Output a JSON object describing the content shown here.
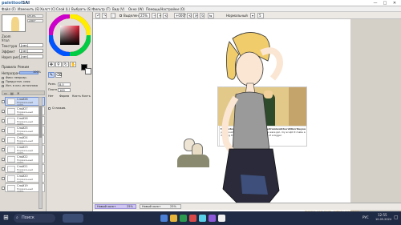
{
  "app": {
    "logo_prefix": "painttool",
    "logo_name": "SAI"
  },
  "window_controls": {
    "minimize": "—",
    "maximize": "□",
    "close": "✕"
  },
  "menu": [
    "Файл (F)",
    "Изменить (E)",
    "Холст (C)",
    "Слой (L)",
    "Выбрать (S)",
    "Фильтр (T)",
    "Вид (V)",
    "Окно (W)",
    "Помощь/Настройки (O)"
  ],
  "toolbar": {
    "selection_label": "Выделение",
    "zoom": "25%",
    "angle": "+000°",
    "mode_label": "Нормальный",
    "stabilizer": "5"
  },
  "sidebar": {
    "navigator": {
      "zoom_label": "Zoom",
      "zoom_value": "25,0%",
      "angle_label": "Угол",
      "angle_value": "+000°"
    },
    "texture_label": "Текстура",
    "texture_value": "[нет]",
    "effect_label": "Эффект",
    "effect_value": "[нет]",
    "wsat_label": "Нарез рисунок",
    "wsat_value": "[нет]",
    "tabs": [
      "Правила",
      "Режим"
    ],
    "opacity_label": "Непрозрачн.",
    "opacity_value": "100%",
    "options": [
      "Фикс непрозр.",
      "Предустан. слоя",
      "Исп. в кач. источника"
    ],
    "layers": [
      {
        "name": "Слой28",
        "mode": "Нормальный",
        "opacity": "100%",
        "selected": true
      },
      {
        "name": "Слой27",
        "mode": "Нормальный",
        "opacity": "100%",
        "selected": false
      },
      {
        "name": "Слой26",
        "mode": "Нормальный",
        "opacity": "100%",
        "selected": false
      },
      {
        "name": "Слой25",
        "mode": "Нормальный",
        "opacity": "100%",
        "selected": false
      },
      {
        "name": "Слой24",
        "mode": "Нормальный",
        "opacity": "100%",
        "selected": false
      },
      {
        "name": "Слой23",
        "mode": "Нормальный",
        "opacity": "100%",
        "selected": false
      },
      {
        "name": "Слой22",
        "mode": "Нормальный",
        "opacity": "100%",
        "selected": false
      },
      {
        "name": "Слой21",
        "mode": "Нормальный",
        "opacity": "100%",
        "selected": false
      },
      {
        "name": "Слой20",
        "mode": "Нормальный",
        "opacity": "100%",
        "selected": false
      },
      {
        "name": "Слой19",
        "mode": "Нормальный",
        "opacity": "100%",
        "selected": false
      }
    ]
  },
  "tools": {
    "size_label": "Разм.",
    "size_value": "8.0",
    "density_label": "Плотн.",
    "density_value": "100",
    "more_labels": [
      "Нет",
      "Форма",
      "Кисть",
      "Кисть"
    ],
    "antialias_label": "Сглажив."
  },
  "canvas": {
    "meme": {
      "caption_left_user": "thebestuyout",
      "caption_left_text": "you should be addicted to drawing this fluff no",
      "caption_right_user": "pastramiwatchers80scribeyou",
      "caption_right_text": "You were ppl, my sculpt it make a bit of a bigger"
    }
  },
  "status": {
    "doc_name": "Новый холст",
    "doc_pct": "25%",
    "doc2_name": "Новый холст",
    "doc2_pct": "25%"
  },
  "notice": "Заметка: мало места, свободных ресурсов",
  "taskbar": {
    "search_label": "Поиск",
    "lang": "РУС",
    "time": "12:55",
    "date": "10.05.2024"
  },
  "colors": {
    "accent": "#3a6ea5",
    "layer_selected": "#c9d8f5",
    "taskbar": "#1f2a44",
    "hair": "#f1cc6a",
    "shirt": "#9a9a9a",
    "jacket": "#2a2a3a"
  }
}
